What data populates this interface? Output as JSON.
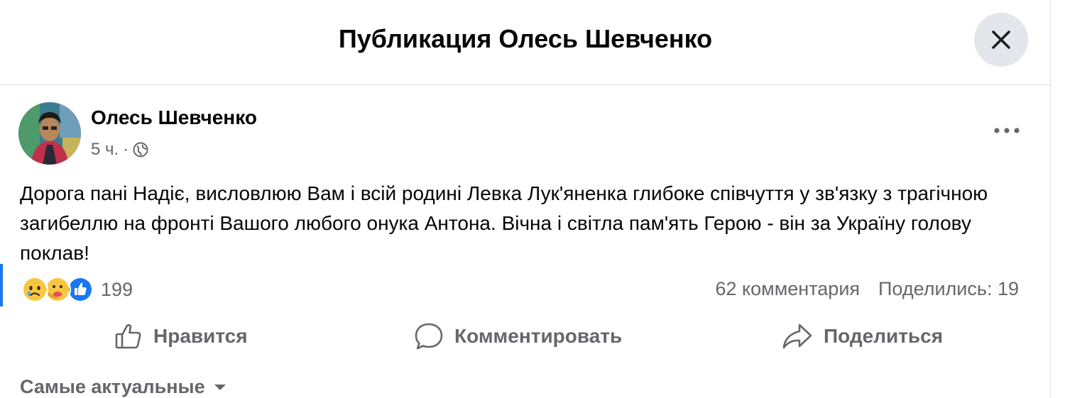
{
  "dialog": {
    "title": "Публикация Олесь Шевченко",
    "close_icon": "close-icon"
  },
  "post": {
    "author": "Олесь Шевченко",
    "time": "5 ч.",
    "separator": "·",
    "privacy_icon": "globe-icon",
    "text": "Дорога пані Надіє, висловлюю Вам і всій родині Левка Лук'яненка глибоке співчуття у зв'язку з трагічною загибеллю на фронті Вашого любого онука Антона. Вічна і світла пам'ять Герою - він за Україну голову поклав!"
  },
  "reactions": {
    "icons": [
      "sad-icon",
      "care-icon",
      "like-icon"
    ],
    "count": "199",
    "comments": "62 комментария",
    "shares": "Поделились: 19"
  },
  "actions": {
    "like": "Нравится",
    "comment": "Комментировать",
    "share": "Поделиться"
  },
  "comments_sort": {
    "label": "Самые актуальные"
  },
  "colors": {
    "accent": "#1877f2",
    "secondary_text": "#65676b",
    "close_bg": "#e4e6eb"
  }
}
